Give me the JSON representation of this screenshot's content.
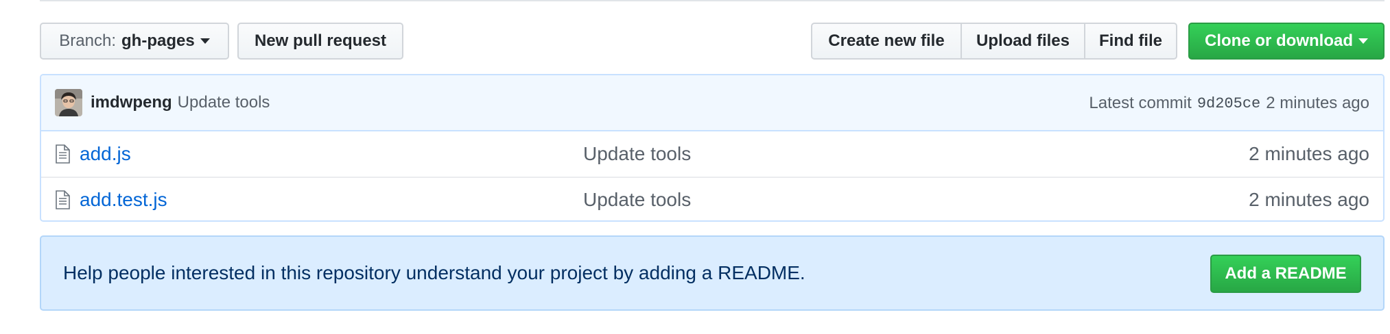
{
  "toolbar": {
    "branch_prefix": "Branch:",
    "branch_name": "gh-pages",
    "new_pull_request": "New pull request",
    "create_new_file": "Create new file",
    "upload_files": "Upload files",
    "find_file": "Find file",
    "clone_or_download": "Clone or download"
  },
  "latest_commit": {
    "author": "imdwpeng",
    "message": "Update tools",
    "label": "Latest commit",
    "sha": "9d205ce",
    "age": "2 minutes ago"
  },
  "files": [
    {
      "icon": "file-icon",
      "name": "add.js",
      "commit_message": "Update tools",
      "age": "2 minutes ago"
    },
    {
      "icon": "file-icon",
      "name": "add.test.js",
      "commit_message": "Update tools",
      "age": "2 minutes ago"
    }
  ],
  "readme_prompt": {
    "text": "Help people interested in this repository understand your project by adding a README.",
    "button": "Add a README"
  },
  "colors": {
    "link": "#0366d6",
    "primary_green": "#28a745",
    "commit_bar_bg": "#f1f8ff",
    "readme_bg": "#dbedff"
  }
}
